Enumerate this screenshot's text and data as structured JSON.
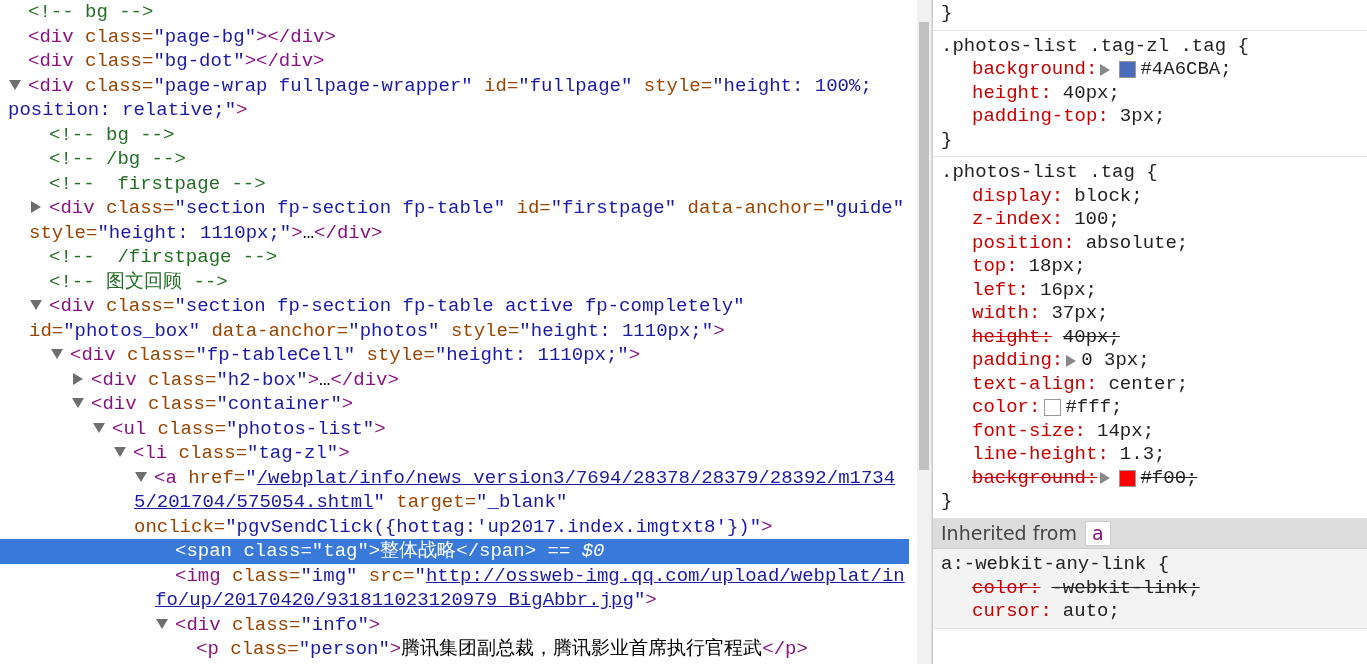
{
  "elements_tree": [
    {
      "tokens": [
        {
          "kind": "comment",
          "text": "<!-- bg -->"
        }
      ]
    },
    {
      "tokens": [
        {
          "kind": "tag",
          "text": "<div"
        },
        {
          "kind": "attr",
          "text": " class="
        },
        {
          "kind": "val",
          "text": "\"page-bg\""
        },
        {
          "kind": "tag",
          "text": "></div>"
        }
      ]
    },
    {
      "tokens": [
        {
          "kind": "tag",
          "text": "<div"
        },
        {
          "kind": "attr",
          "text": " class="
        },
        {
          "kind": "val",
          "text": "\"bg-dot\""
        },
        {
          "kind": "tag",
          "text": "></div>"
        }
      ]
    },
    {
      "expanded": true,
      "selected": false,
      "tokens": [
        {
          "kind": "tag",
          "text": "<div"
        },
        {
          "kind": "attr",
          "text": " class="
        },
        {
          "kind": "val",
          "text": "\"page-wrap fullpage-wrapper\""
        },
        {
          "kind": "attr",
          "text": " id="
        },
        {
          "kind": "val",
          "text": "\"fullpage\""
        },
        {
          "kind": "attr",
          "text": " style="
        },
        {
          "kind": "val",
          "text": "\"height: 100%; position: relative;\""
        },
        {
          "kind": "tag",
          "text": ">"
        }
      ],
      "children": [
        {
          "tokens": [
            {
              "kind": "comment",
              "text": "<!-- bg -->"
            }
          ]
        },
        {
          "tokens": [
            {
              "kind": "comment",
              "text": "<!-- /bg -->"
            }
          ]
        },
        {
          "tokens": [
            {
              "kind": "comment",
              "text": "<!--  firstpage -->"
            }
          ]
        },
        {
          "expanded": false,
          "selected": false,
          "tokens": [
            {
              "kind": "tag",
              "text": "<div"
            },
            {
              "kind": "attr",
              "text": " class="
            },
            {
              "kind": "val",
              "text": "\"section fp-section fp-table\""
            },
            {
              "kind": "attr",
              "text": " id="
            },
            {
              "kind": "val",
              "text": "\"firstpage\""
            },
            {
              "kind": "attr",
              "text": " data-anchor="
            },
            {
              "kind": "val",
              "text": "\"guide\""
            },
            {
              "kind": "attr",
              "text": " style="
            },
            {
              "kind": "val",
              "text": "\"height: 1110px;\""
            },
            {
              "kind": "tag",
              "text": ">"
            },
            {
              "kind": "text",
              "text": "…"
            },
            {
              "kind": "tag",
              "text": "</div>"
            }
          ]
        },
        {
          "tokens": [
            {
              "kind": "comment",
              "text": "<!--  /firstpage -->"
            }
          ]
        },
        {
          "tokens": [
            {
              "kind": "comment",
              "text": "<!-- 图文回顾 -->"
            }
          ]
        },
        {
          "expanded": true,
          "selected": false,
          "tokens": [
            {
              "kind": "tag",
              "text": "<div"
            },
            {
              "kind": "attr",
              "text": " class="
            },
            {
              "kind": "val",
              "text": "\"section fp-section fp-table active fp-completely\""
            },
            {
              "kind": "attr",
              "text": " id="
            },
            {
              "kind": "val",
              "text": "\"photos_box\""
            },
            {
              "kind": "attr",
              "text": " data-anchor="
            },
            {
              "kind": "val",
              "text": "\"photos\""
            },
            {
              "kind": "attr",
              "text": " style="
            },
            {
              "kind": "val",
              "text": "\"height: 1110px;\""
            },
            {
              "kind": "tag",
              "text": ">"
            }
          ],
          "children": [
            {
              "expanded": true,
              "selected": false,
              "tokens": [
                {
                  "kind": "tag",
                  "text": "<div"
                },
                {
                  "kind": "attr",
                  "text": " class="
                },
                {
                  "kind": "val",
                  "text": "\"fp-tableCell\""
                },
                {
                  "kind": "attr",
                  "text": " style="
                },
                {
                  "kind": "val",
                  "text": "\"height: 1110px;\""
                },
                {
                  "kind": "tag",
                  "text": ">"
                }
              ],
              "children": [
                {
                  "expanded": false,
                  "selected": false,
                  "tokens": [
                    {
                      "kind": "tag",
                      "text": "<div"
                    },
                    {
                      "kind": "attr",
                      "text": " class="
                    },
                    {
                      "kind": "val",
                      "text": "\"h2-box\""
                    },
                    {
                      "kind": "tag",
                      "text": ">"
                    },
                    {
                      "kind": "text",
                      "text": "…"
                    },
                    {
                      "kind": "tag",
                      "text": "</div>"
                    }
                  ]
                },
                {
                  "expanded": true,
                  "selected": false,
                  "tokens": [
                    {
                      "kind": "tag",
                      "text": "<div"
                    },
                    {
                      "kind": "attr",
                      "text": " class="
                    },
                    {
                      "kind": "val",
                      "text": "\"container\""
                    },
                    {
                      "kind": "tag",
                      "text": ">"
                    }
                  ],
                  "children": [
                    {
                      "expanded": true,
                      "selected": false,
                      "tokens": [
                        {
                          "kind": "tag",
                          "text": "<ul"
                        },
                        {
                          "kind": "attr",
                          "text": " class="
                        },
                        {
                          "kind": "val",
                          "text": "\"photos-list\""
                        },
                        {
                          "kind": "tag",
                          "text": ">"
                        }
                      ],
                      "children": [
                        {
                          "expanded": true,
                          "selected": false,
                          "tokens": [
                            {
                              "kind": "tag",
                              "text": "<li"
                            },
                            {
                              "kind": "attr",
                              "text": " class="
                            },
                            {
                              "kind": "val",
                              "text": "\"tag-zl\""
                            },
                            {
                              "kind": "tag",
                              "text": ">"
                            }
                          ],
                          "children": [
                            {
                              "expanded": true,
                              "selected": false,
                              "tokens": [
                                {
                                  "kind": "tag",
                                  "text": "<a"
                                },
                                {
                                  "kind": "attr",
                                  "text": " href="
                                },
                                {
                                  "kind": "val",
                                  "text": "\""
                                },
                                {
                                  "kind": "link",
                                  "text": "/webplat/info/news_version3/7694/28378/28379/28392/m17345/201704/575054.shtml"
                                },
                                {
                                  "kind": "val",
                                  "text": "\""
                                },
                                {
                                  "kind": "attr",
                                  "text": " target="
                                },
                                {
                                  "kind": "val",
                                  "text": "\"_blank\""
                                },
                                {
                                  "kind": "attr",
                                  "text": " onclick="
                                },
                                {
                                  "kind": "val",
                                  "text": "\"pgvSendClick({hottag:'up2017.index.imgtxt8'})\""
                                },
                                {
                                  "kind": "tag",
                                  "text": ">"
                                }
                              ],
                              "children": [
                                {
                                  "selected": true,
                                  "tokens": [
                                    {
                                      "kind": "tag",
                                      "text": "<span"
                                    },
                                    {
                                      "kind": "attr",
                                      "text": " class="
                                    },
                                    {
                                      "kind": "val",
                                      "text": "\"tag\""
                                    },
                                    {
                                      "kind": "tag",
                                      "text": ">"
                                    },
                                    {
                                      "kind": "text",
                                      "text": "整体战略"
                                    },
                                    {
                                      "kind": "tag",
                                      "text": "</span>"
                                    },
                                    {
                                      "kind": "marker",
                                      "text": " == $0"
                                    }
                                  ]
                                },
                                {
                                  "selected": false,
                                  "tokens": [
                                    {
                                      "kind": "tag",
                                      "text": "<img"
                                    },
                                    {
                                      "kind": "attr",
                                      "text": " class="
                                    },
                                    {
                                      "kind": "val",
                                      "text": "\"img\""
                                    },
                                    {
                                      "kind": "attr",
                                      "text": " src="
                                    },
                                    {
                                      "kind": "val",
                                      "text": "\""
                                    },
                                    {
                                      "kind": "link",
                                      "text": "http://ossweb-img.qq.com/upload/webplat/info/up/20170420/931811023120979_BigAbbr.jpg"
                                    },
                                    {
                                      "kind": "val",
                                      "text": "\""
                                    },
                                    {
                                      "kind": "tag",
                                      "text": ">"
                                    }
                                  ]
                                },
                                {
                                  "expanded": true,
                                  "selected": false,
                                  "tokens": [
                                    {
                                      "kind": "tag",
                                      "text": "<div"
                                    },
                                    {
                                      "kind": "attr",
                                      "text": " class="
                                    },
                                    {
                                      "kind": "val",
                                      "text": "\"info\""
                                    },
                                    {
                                      "kind": "tag",
                                      "text": ">"
                                    }
                                  ],
                                  "children": [
                                    {
                                      "selected": false,
                                      "tokens": [
                                        {
                                          "kind": "tag",
                                          "text": "<p"
                                        },
                                        {
                                          "kind": "attr",
                                          "text": " class="
                                        },
                                        {
                                          "kind": "val",
                                          "text": "\"person\""
                                        },
                                        {
                                          "kind": "tag",
                                          "text": ">"
                                        },
                                        {
                                          "kind": "text",
                                          "text": "腾讯集团副总裁，腾讯影业首席执行官程武"
                                        },
                                        {
                                          "kind": "tag",
                                          "text": "</p>"
                                        }
                                      ]
                                    }
                                  ]
                                }
                              ]
                            }
                          ]
                        }
                      ]
                    }
                  ]
                }
              ]
            }
          ]
        }
      ]
    }
  ],
  "styles_pane": {
    "rules": [
      {
        "close": "}"
      },
      {
        "selector": ".photos-list .tag-zl .tag {",
        "close": "}",
        "properties": [
          {
            "name": "background:",
            "value": "#4A6CBA;",
            "struck": false,
            "expandable": true,
            "color": "#4a6cba"
          },
          {
            "name": "height:",
            "value": "40px;",
            "struck": false
          },
          {
            "name": "padding-top:",
            "value": "3px;",
            "struck": false
          }
        ]
      },
      {
        "selector": ".photos-list .tag {",
        "close": "}",
        "properties": [
          {
            "name": "display:",
            "value": "block;",
            "struck": false
          },
          {
            "name": "z-index:",
            "value": "100;",
            "struck": false
          },
          {
            "name": "position:",
            "value": "absolute;",
            "struck": false
          },
          {
            "name": "top:",
            "value": "18px;",
            "struck": false
          },
          {
            "name": "left:",
            "value": "16px;",
            "struck": false
          },
          {
            "name": "width:",
            "value": "37px;",
            "struck": false
          },
          {
            "name": "height:",
            "value": "40px;",
            "struck": true
          },
          {
            "name": "padding:",
            "value": "0 3px;",
            "struck": false,
            "expandable": true
          },
          {
            "name": "text-align:",
            "value": "center;",
            "struck": false
          },
          {
            "name": "color:",
            "value": "#fff;",
            "struck": false,
            "color": "#ffffff"
          },
          {
            "name": "font-size:",
            "value": "14px;",
            "struck": false
          },
          {
            "name": "line-height:",
            "value": "1.3;",
            "struck": false
          },
          {
            "name": "background:",
            "value": "#f00;",
            "struck": true,
            "expandable": true,
            "color": "#ff0000"
          }
        ]
      }
    ],
    "inherited": {
      "label": "Inherited from",
      "element": "a",
      "rules": [
        {
          "selector": "a:-webkit-any-link {",
          "properties": [
            {
              "name": "color:",
              "value": "-webkit-link;",
              "struck": true
            },
            {
              "name": "cursor:",
              "value": "auto;",
              "struck": false
            }
          ]
        }
      ]
    }
  }
}
